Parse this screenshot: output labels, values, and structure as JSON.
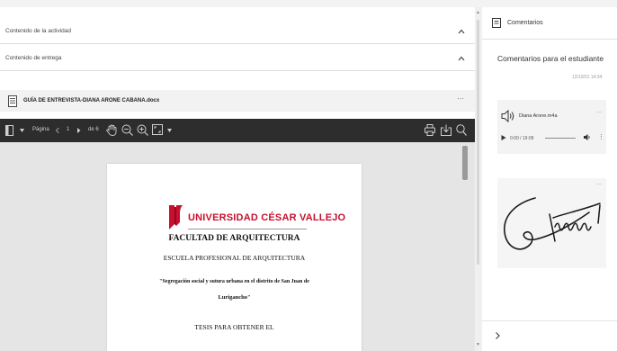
{
  "accordion": [
    {
      "label": "Contenido de la actividad",
      "state": "expanded"
    },
    {
      "label": "Contenido de entrega",
      "state": "expanded"
    }
  ],
  "file": {
    "name": "GUÍA DE ENTREVISTA-DIANA ARONE CABANA.docx",
    "more": "···"
  },
  "viewer_toolbar": {
    "page_label": "Página",
    "current_page": "1",
    "total_pages": "de 6"
  },
  "document": {
    "university": "UNIVERSIDAD CÉSAR VALLEJO",
    "faculty": "FACULTAD DE ARQUITECTURA",
    "school": "ESCUELA PROFESIONAL DE ARQUITECTURA",
    "title_line1": "\"Segregación social y sutura urbana en el distrito de San Juan de",
    "title_line2": "Lurigancho\"",
    "thesis_line": "TESIS PARA OBTENER EL"
  },
  "comments": {
    "header": "Comentarios",
    "subtitle": "Comentarios para el estudiante",
    "date": "12/10/21 14:34",
    "audio": {
      "filename": "Diana Arone.m4a",
      "time": "0:00 / 19:09",
      "more": "···"
    },
    "signature_more": "···"
  },
  "colors": {
    "toolbar_bg": "#2d2d2d",
    "brand_red": "#c8102e",
    "viewer_bg": "#e5e5e5"
  }
}
